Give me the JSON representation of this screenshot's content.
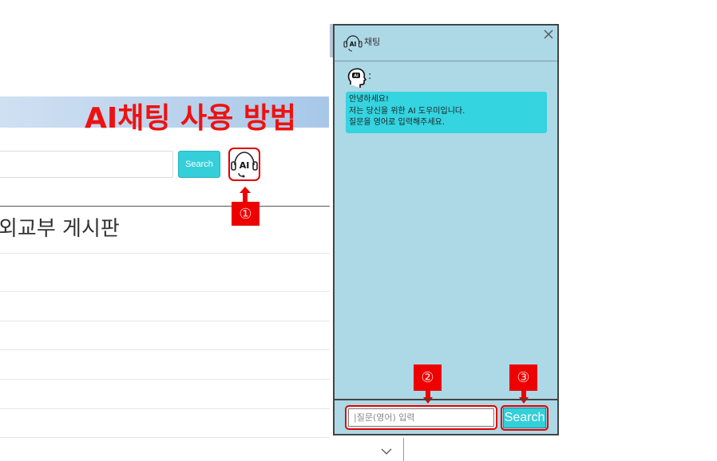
{
  "page": {
    "heading": "AI채팅 사용 방법",
    "search_button_label": "Search",
    "board_title": "외교부 게시판"
  },
  "annotations": {
    "step1": "①",
    "step2": "②",
    "step3": "③",
    "highlight_color": "#ee0000"
  },
  "chat": {
    "title": "채팅",
    "icon": "ai-headset-icon",
    "bot_label": ":",
    "greeting_lines": [
      "안녕하세요!",
      "저는 당신을 위한 AI 도우미입니다.",
      "질문을 영어로 입력해주세요."
    ],
    "input_placeholder": "|질문(영어) 입력",
    "send_label": "Search",
    "panel_color": "#add8e6",
    "bubble_color": "#34d4e0"
  }
}
